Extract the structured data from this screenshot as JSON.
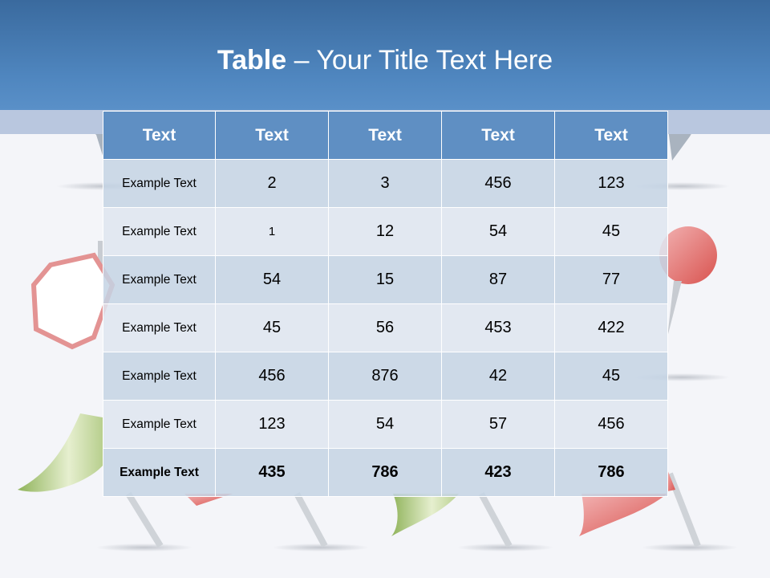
{
  "title": {
    "bold": "Table",
    "rest": " – Your Title Text Here"
  },
  "table": {
    "headers": [
      "Text",
      "Text",
      "Text",
      "Text",
      "Text"
    ],
    "rows": [
      [
        "Example Text",
        "2",
        "3",
        "456",
        "123"
      ],
      [
        "Example Text",
        "1",
        "12",
        "54",
        "45"
      ],
      [
        "Example Text",
        "54",
        "15",
        "87",
        "77"
      ],
      [
        "Example Text",
        "45",
        "56",
        "453",
        "422"
      ],
      [
        "Example Text",
        "456",
        "876",
        "42",
        "45"
      ],
      [
        "Example Text",
        "123",
        "54",
        "57",
        "456"
      ],
      [
        "Example Text",
        "435",
        "786",
        "423",
        "786"
      ]
    ]
  },
  "colors": {
    "header_band": "#4f86bf",
    "table_header": "#5f8fc3",
    "row_dark": "#c4d3e4",
    "row_light": "#dee5f0",
    "flag_green": "#9dbf6a",
    "pin_red": "#d9534f"
  },
  "decor": [
    "pushpin-icon",
    "flag-pin-icon",
    "hexagon-pin-icon",
    "round-pin-icon"
  ]
}
